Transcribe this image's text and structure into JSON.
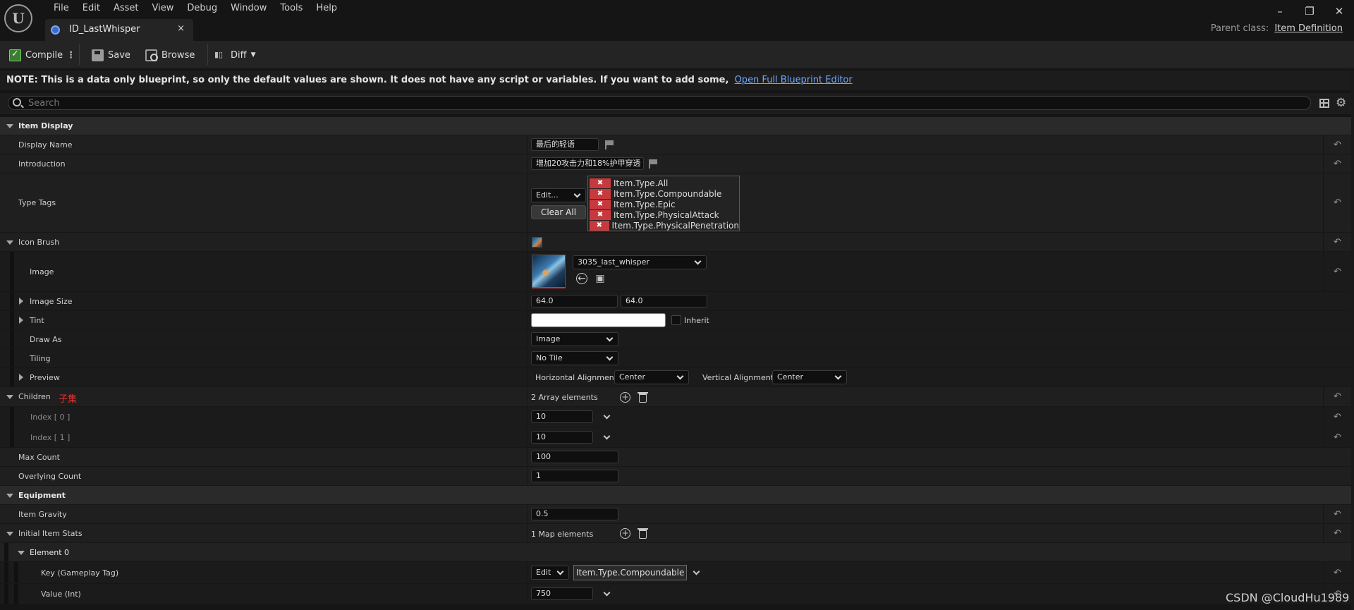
{
  "menu": [
    "File",
    "Edit",
    "Asset",
    "View",
    "Debug",
    "Window",
    "Tools",
    "Help"
  ],
  "tab": {
    "title": "ID_LastWhisper",
    "close": "×"
  },
  "window_controls": {
    "minimize": "–",
    "restore": "❐",
    "close": "✕"
  },
  "parent_class": {
    "label": "Parent class:",
    "value": "Item Definition"
  },
  "toolbar": {
    "compile": "Compile",
    "save": "Save",
    "browse": "Browse",
    "diff": "Diff"
  },
  "note": {
    "text": "NOTE: This is a data only blueprint, so only the default values are shown.  It does not have any script or variables.  If you want to add some,",
    "link": "Open Full Blueprint Editor"
  },
  "search": {
    "placeholder": "Search",
    "value": ""
  },
  "sections": {
    "item_display": "Item Display",
    "display_name": {
      "label": "Display Name",
      "value": "最后的轻语"
    },
    "introduction": {
      "label": "Introduction",
      "value": "增加20攻击力和18%护甲穿透"
    },
    "type_tags": {
      "label": "Type Tags",
      "edit": "Edit...",
      "clear_all": "Clear All",
      "tags": [
        "Item.Type.All",
        "Item.Type.Compoundable",
        "Item.Type.Epic",
        "Item.Type.PhysicalAttack",
        "Item.Type.PhysicalPenetration"
      ]
    },
    "icon_brush": "Icon Brush",
    "image": {
      "label": "Image",
      "value": "3035_last_whisper"
    },
    "image_size": {
      "label": "Image Size",
      "x": "64.0",
      "y": "64.0"
    },
    "tint": {
      "label": "Tint",
      "inherit": "Inherit"
    },
    "draw_as": {
      "label": "Draw As",
      "value": "Image"
    },
    "tiling": {
      "label": "Tiling",
      "value": "No Tile"
    },
    "preview": {
      "label": "Preview",
      "h_label": "Horizontal Alignment",
      "h_value": "Center",
      "v_label": "Vertical Alignment",
      "v_value": "Center"
    },
    "children": {
      "label": "Children",
      "annotation": "子集",
      "count": "2 Array elements",
      "items": [
        {
          "label": "Index [ 0 ]",
          "value": "10"
        },
        {
          "label": "Index [ 1 ]",
          "value": "10"
        }
      ]
    },
    "max_count": {
      "label": "Max Count",
      "value": "100"
    },
    "overlying_count": {
      "label": "Overlying Count",
      "value": "1"
    },
    "equipment": "Equipment",
    "item_gravity": {
      "label": "Item Gravity",
      "value": "0.5"
    },
    "initial_item_stats": {
      "label": "Initial Item Stats",
      "count": "1 Map elements"
    },
    "element0": {
      "label": "Element 0"
    },
    "key": {
      "label": "Key (Gameplay Tag)",
      "edit": "Edit",
      "value": "Item.Type.Compoundable"
    },
    "value_int": {
      "label": "Value (Int)",
      "value": "750"
    }
  },
  "watermark": "CSDN @CloudHu1989",
  "icons": [
    "unreal-logo-icon",
    "blueprint-icon",
    "compile-icon",
    "save-icon",
    "browse-icon",
    "diff-icon",
    "search-icon",
    "table-view-icon",
    "settings-icon",
    "flag-icon",
    "reset-arrow-icon",
    "add-circle-icon",
    "trash-icon"
  ],
  "colors": {
    "background": "#151515",
    "panel": "#1f1f1f",
    "accent_link": "#6fa8ff",
    "tag_remove": "#c8393d",
    "annotation_red": "#e03030"
  }
}
